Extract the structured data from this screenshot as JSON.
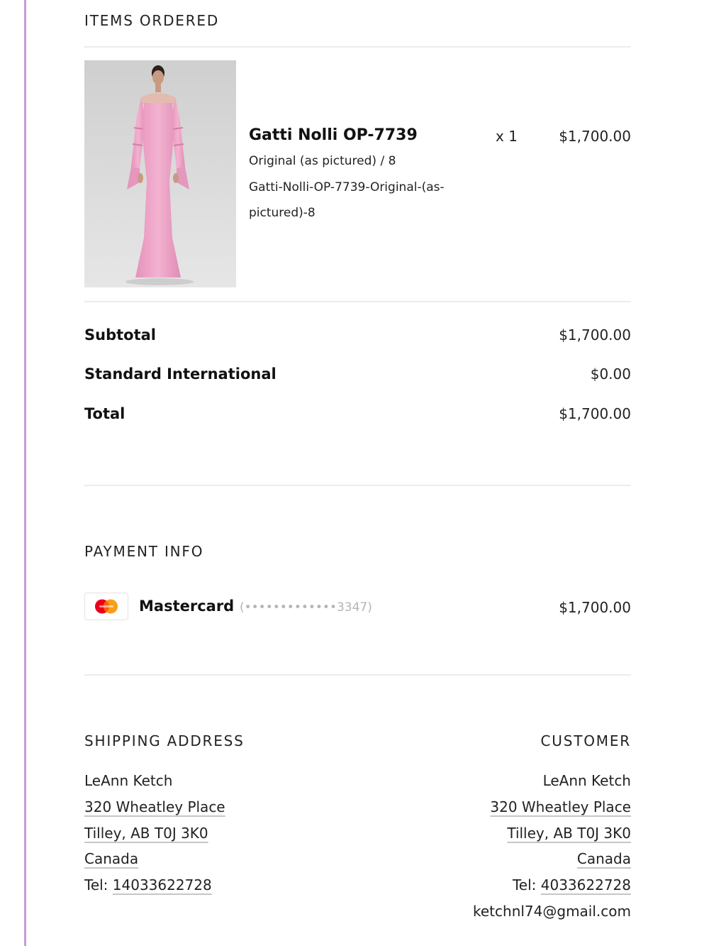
{
  "sections": {
    "items_heading": "ITEMS ORDERED",
    "payment_heading": "PAYMENT INFO",
    "shipping_heading": "SHIPPING ADDRESS",
    "customer_heading": "CUSTOMER"
  },
  "item": {
    "name": "Gatti Nolli OP-7739",
    "variant": "Original (as pictured) / 8",
    "sku": "Gatti-Nolli-OP-7739-Original-(as-pictured)-8",
    "quantity": "x 1",
    "price": "$1,700.00",
    "image_icon": "pink-gown-product-photo"
  },
  "totals": [
    {
      "label": "Subtotal",
      "value": "$1,700.00"
    },
    {
      "label": "Standard International",
      "value": "$0.00"
    },
    {
      "label": "Total",
      "value": "$1,700.00"
    }
  ],
  "payment": {
    "card_brand": "Mastercard",
    "card_mask": "(•••••••••••••3347)",
    "amount": "$1,700.00",
    "card_icon": "mastercard-icon"
  },
  "shipping": {
    "name": "LeAnn Ketch",
    "street": "320 Wheatley Place",
    "city": "Tilley, AB T0J 3K0",
    "country": "Canada",
    "tel_label": "Tel: ",
    "tel": "14033622728"
  },
  "customer": {
    "name": "LeAnn Ketch",
    "street": "320 Wheatley Place",
    "city": "Tilley, AB T0J 3K0",
    "country": "Canada",
    "tel_label": "Tel: ",
    "tel": "4033622728",
    "email": "ketchnl74@gmail.com"
  },
  "colors": {
    "left_rule": "#c99bd6",
    "divider": "#ececec",
    "dress": "#f0a8c8",
    "mastercard_red": "#eb001b",
    "mastercard_orange": "#f79e1b"
  }
}
